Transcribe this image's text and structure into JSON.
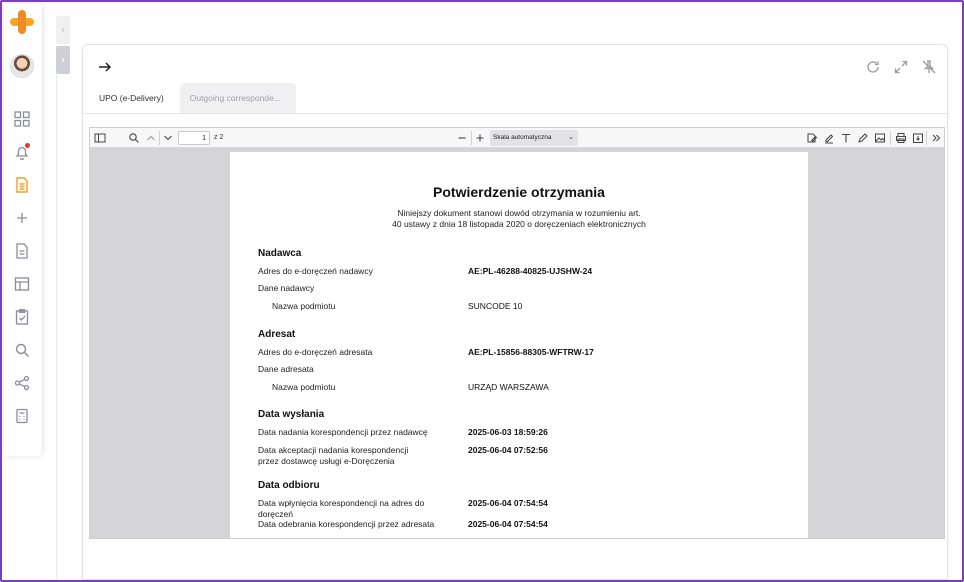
{
  "sidebar": {
    "nav": [
      {
        "icon": "dashboard-grid-icon"
      },
      {
        "icon": "bell-icon",
        "badge": true
      },
      {
        "icon": "document-list-icon",
        "active": true
      },
      {
        "icon": "plus-icon"
      },
      {
        "icon": "file-icon"
      },
      {
        "icon": "layout-icon"
      },
      {
        "icon": "clipboard-check-icon"
      },
      {
        "icon": "search-icon"
      },
      {
        "icon": "share-icon"
      },
      {
        "icon": "calculator-icon"
      }
    ]
  },
  "panel": {
    "tabs": [
      {
        "label": "UPO (e-Delivery)",
        "active": true
      },
      {
        "label": "Outgoing corresponde...",
        "active": false
      }
    ]
  },
  "viewer": {
    "page_current": "1",
    "page_total": "z 2",
    "scale": "Skala automatyczna"
  },
  "document": {
    "title": "Potwierdzenie otrzymania",
    "subtitle_line1": "Niniejszy dokument stanowi dowód otrzymania w rozumieniu art.",
    "subtitle_line2": "40 ustawy z dnia 18 listopada 2020 o doręczeniach elektronicznych",
    "sender": {
      "heading": "Nadawca",
      "address_label": "Adres do e-doręczeń nadawcy",
      "address_value": "AE:PL-46288-40825-UJSHW-24",
      "data_label": "Dane nadawcy",
      "name_label": "Nazwa podmiotu",
      "name_value": "SUNCODE 10"
    },
    "recipient": {
      "heading": "Adresat",
      "address_label": "Adres do e-doręczeń adresata",
      "address_value": "AE:PL-15856-88305-WFTRW-17",
      "data_label": "Dane adresata",
      "name_label": "Nazwa podmiotu",
      "name_value": "URZĄD WARSZAWA"
    },
    "sending": {
      "heading": "Data wysłania",
      "row1_label": "Data nadania korespondencji przez nadawcę",
      "row1_value": "2025-06-03 18:59:26",
      "row2_label_line1": "Data akceptacji nadania korespondencji",
      "row2_label_line2": "przez dostawcę usługi e-Doręczenia",
      "row2_value": "2025-06-04 07:52:56"
    },
    "receipt": {
      "heading": "Data odbioru",
      "row1_label_line1": "Data wpłynięcia korespondencji na adres do",
      "row1_label_line2": "doręczeń",
      "row1_value": "2025-06-04 07:54:54",
      "row2_label": "Data odebrania korespondencji przez adresata",
      "row2_value": "2025-06-04 07:54:54"
    }
  }
}
